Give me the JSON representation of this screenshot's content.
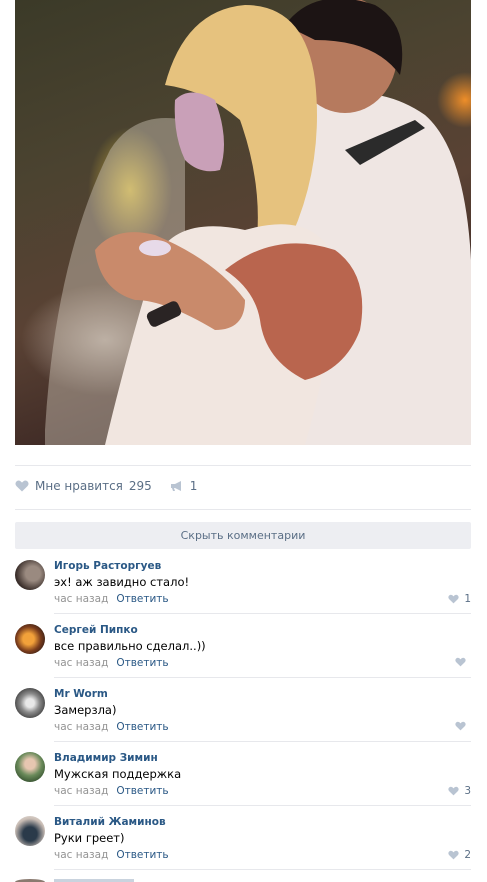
{
  "post": {
    "photo_alt": "photo",
    "likes_label": "Мне нравится",
    "likes_count": "295",
    "shares_count": "1"
  },
  "comments_block": {
    "hide_label": "Скрыть комментарии",
    "items": [
      {
        "author": "Игорь Расторгуев",
        "text": "эх! аж завидно стало!",
        "time": "час назад",
        "reply": "Ответить",
        "likes": "1"
      },
      {
        "author": "Сергей Пипко",
        "text": "все правильно сделал..))",
        "time": "час назад",
        "reply": "Ответить",
        "likes": ""
      },
      {
        "author": "Mr Worm",
        "text": "Замерзла)",
        "time": "час назад",
        "reply": "Ответить",
        "likes": ""
      },
      {
        "author": "Владимир Зимин",
        "text": "Мужская поддержка",
        "time": "час назад",
        "reply": "Ответить",
        "likes": "3"
      },
      {
        "author": "Виталий Жаминов",
        "text": "Руки греет)",
        "time": "час назад",
        "reply": "Ответить",
        "likes": "2"
      }
    ]
  },
  "colors": {
    "link": "#2a5885",
    "muted": "#939393",
    "action": "#5b6f86",
    "divider": "#e7e8ec",
    "button_bg": "#edeef2"
  },
  "icons": [
    "heart-icon",
    "megaphone-icon"
  ]
}
